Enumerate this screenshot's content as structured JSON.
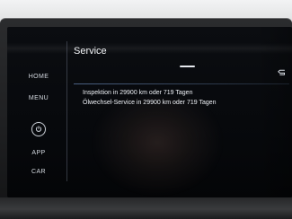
{
  "sidebar": {
    "items": [
      {
        "label": "HOME"
      },
      {
        "label": "MENU"
      },
      {
        "label": "APP"
      },
      {
        "label": "CAR"
      }
    ],
    "power_icon": "power-icon"
  },
  "main": {
    "title": "Service",
    "entries": [
      {
        "text": "Inspektion in 29900 km oder 719 Tagen"
      },
      {
        "text": "Ölwechsel-Service in 29900 km oder 719 Tagen"
      }
    ]
  },
  "colors": {
    "text_primary": "#eef1f6",
    "accent_line": "#617eaa",
    "screen_bg": "#06080b"
  },
  "icons": {
    "top_indicator": "page-indicator",
    "right_edge": "back-arrow-icon"
  }
}
